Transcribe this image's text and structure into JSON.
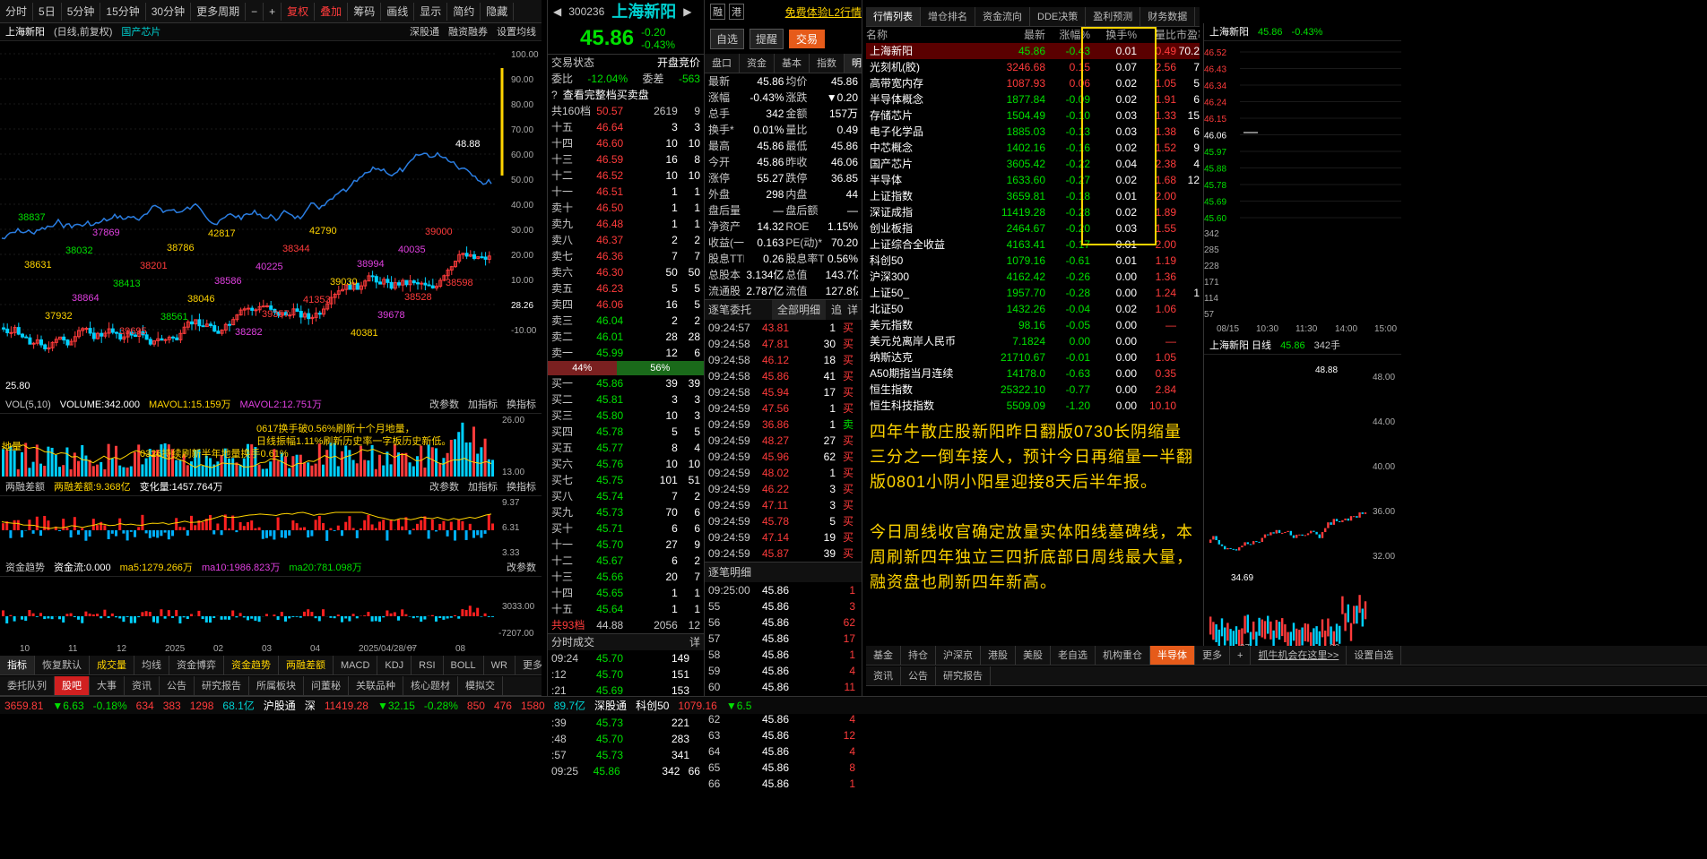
{
  "toolbar": {
    "items": [
      "分时",
      "5日",
      "5分钟",
      "15分钟",
      "30分钟",
      "更多周期"
    ],
    "tools": [
      "复权",
      "叠加",
      "筹码",
      "画线",
      "显示",
      "简约",
      "隐藏"
    ]
  },
  "chart_head": {
    "name": "上海新阳",
    "desc": "(日线,前复权)",
    "tag": "国产芯片",
    "deep": "深股通",
    "rz": "融资融券",
    "set": "设置均线"
  },
  "main_chart": {
    "high_label": "48.88",
    "low_label": "25.80",
    "y_ticks": [
      "100.00",
      "90.00",
      "80.00",
      "70.00",
      "60.00",
      "50.00",
      "40.00",
      "30.00",
      "20.00",
      "10.00",
      "28.26",
      "-10.00"
    ],
    "annos": [
      "38837",
      "38032",
      "38413",
      "38561",
      "42817",
      "40225",
      "41353",
      "40381",
      "40035",
      "38598",
      "37932",
      "37869",
      "38201",
      "38046",
      "38282",
      "38344",
      "39030",
      "39678",
      "39000",
      "38631",
      "38864",
      "39695",
      "38786",
      "38586",
      "39357",
      "42790",
      "38994",
      "38528"
    ]
  },
  "vol": {
    "title": "VOL(5,10)",
    "vol": "VOLUME:342.000",
    "m1": "MAVOL1:15.159万",
    "m2": "MAVOL2:12.751万",
    "btns": [
      "改参数",
      "加指标",
      "换指标"
    ],
    "note1": "0617换手破0.56%刷新十个月地量，",
    "note2": "日线振幅1.11%刷新历史率一字板历史新低。",
    "note3": "0326持续刷新半年地量换手0.61%",
    "note4": "地量",
    "ticks": [
      "26.00",
      "",
      "13.00"
    ]
  },
  "rz": {
    "title": "两融差额",
    "val": "两融差额:9.368亿",
    "chg": "变化量:1457.764万",
    "ticks": [
      "9.37",
      "6.31",
      "3.33"
    ]
  },
  "zj": {
    "title": "资金趋势",
    "val": "资金流:0.000",
    "m5": "ma5:1279.266万",
    "m10": "ma10:1986.823万",
    "m20": "ma20:781.098万",
    "ticks": [
      "3033.00",
      "-7207.00"
    ]
  },
  "x_axis": [
    "10",
    "11",
    "12",
    "2025",
    "02",
    "03",
    "04",
    "2025/04/28/一",
    "07",
    "08"
  ],
  "bottom_tabs": [
    "指标",
    "恢复默认",
    "成交量",
    "均线",
    "资金博弈",
    "资金趋势",
    "两融差额",
    "MACD",
    "KDJ",
    "RSI",
    "BOLL",
    "WR",
    "更多",
    "模板"
  ],
  "tabs2": [
    "委托队列",
    "股吧",
    "大事",
    "资讯",
    "公告",
    "研究报告",
    "所属板块",
    "问董秘",
    "关联品种",
    "核心题材",
    "模拟交"
  ],
  "quote": {
    "code": "300236",
    "name": "上海新阳",
    "price": "45.86",
    "chg": "-0.20",
    "pct": "-0.43%",
    "b1": "融",
    "b2": "港",
    "l2": "免费体验L2行情",
    "zx": "自选",
    "tx": "提醒",
    "jy": "交易"
  },
  "order_status": {
    "label": "交易状态",
    "val": "开盘竞价",
    "wb": "委比",
    "wbv": "-12.04%",
    "wc": "委差",
    "wcv": "-563",
    "view": "查看完整档买卖盘",
    "total": "共160档",
    "tp": "50.57",
    "tv": "2619",
    "tn": "9"
  },
  "asks": [
    [
      "十五",
      "46.64",
      "3",
      "3"
    ],
    [
      "十四",
      "46.60",
      "10",
      "10"
    ],
    [
      "十三",
      "46.59",
      "16",
      "8"
    ],
    [
      "十二",
      "46.52",
      "10",
      "10"
    ],
    [
      "十一",
      "46.51",
      "1",
      "1"
    ],
    [
      "卖十",
      "46.50",
      "1",
      "1"
    ],
    [
      "卖九",
      "46.48",
      "1",
      "1"
    ],
    [
      "卖八",
      "46.37",
      "2",
      "2"
    ],
    [
      "卖七",
      "46.36",
      "7",
      "7"
    ],
    [
      "卖六",
      "46.30",
      "50",
      "50"
    ],
    [
      "卖五",
      "46.23",
      "5",
      "5"
    ],
    [
      "卖四",
      "46.06",
      "16",
      "5"
    ],
    [
      "卖三",
      "46.04",
      "2",
      "2"
    ],
    [
      "卖二",
      "46.01",
      "28",
      "28"
    ],
    [
      "卖一",
      "45.99",
      "12",
      "6"
    ]
  ],
  "ratio": {
    "l": "44%",
    "r": "56%"
  },
  "bids": [
    [
      "买一",
      "45.86",
      "39",
      "39"
    ],
    [
      "买二",
      "45.81",
      "3",
      "3"
    ],
    [
      "买三",
      "45.80",
      "10",
      "3"
    ],
    [
      "买四",
      "45.78",
      "5",
      "5"
    ],
    [
      "买五",
      "45.77",
      "8",
      "4"
    ],
    [
      "买六",
      "45.76",
      "10",
      "10"
    ],
    [
      "买七",
      "45.75",
      "101",
      "51"
    ],
    [
      "买八",
      "45.74",
      "7",
      "2"
    ],
    [
      "买九",
      "45.73",
      "70",
      "6"
    ],
    [
      "买十",
      "45.71",
      "6",
      "6"
    ],
    [
      "十一",
      "45.70",
      "27",
      "9"
    ],
    [
      "十二",
      "45.67",
      "6",
      "2"
    ],
    [
      "十三",
      "45.66",
      "20",
      "7"
    ],
    [
      "十四",
      "45.65",
      "1",
      "1"
    ],
    [
      "十五",
      "45.64",
      "1",
      "1"
    ]
  ],
  "bid_total": {
    "l": "共93档",
    "p": "44.88",
    "v": "2056",
    "n": "12"
  },
  "fs": {
    "title": "分时成交",
    "btn": "详",
    "rows": [
      [
        "09:24",
        "45.70",
        "149"
      ],
      [
        ":12",
        "45.70",
        "151"
      ],
      [
        ":21",
        "45.69",
        "153"
      ],
      [
        ":30",
        "45.73",
        "187"
      ],
      [
        ":39",
        "45.73",
        "221"
      ],
      [
        ":48",
        "45.70",
        "283"
      ],
      [
        ":57",
        "45.73",
        "341"
      ],
      [
        "09:25",
        "45.86",
        "342",
        "66"
      ]
    ]
  },
  "mtabs": [
    "盘口",
    "资金",
    "基本",
    "指数",
    "明细",
    "逐笔"
  ],
  "detail": [
    [
      "最新",
      "45.86",
      "均价",
      "45.86"
    ],
    [
      "涨幅",
      "-0.43%",
      "涨跌",
      "▼0.20"
    ],
    [
      "总手",
      "342",
      "金额",
      "157万"
    ],
    [
      "换手*",
      "0.01%",
      "量比",
      "0.49"
    ],
    [
      "最高",
      "45.86",
      "最低",
      "45.86"
    ],
    [
      "今开",
      "45.86",
      "昨收",
      "46.06"
    ],
    [
      "涨停",
      "55.27",
      "跌停",
      "36.85"
    ],
    [
      "外盘",
      "298",
      "内盘",
      "44"
    ],
    [
      "盘后量",
      "—",
      "盘后额",
      "—"
    ],
    [
      "净资产",
      "14.32",
      "ROE",
      "1.15%"
    ],
    [
      "收益(一)",
      "0.163",
      "PE(动)*",
      "70.20"
    ],
    [
      "股息TTM",
      "0.26",
      "股息率TTM",
      "0.56%"
    ],
    [
      "总股本",
      "3.134亿",
      "总值",
      "143.7亿"
    ],
    [
      "流通股",
      "2.787亿",
      "流值",
      "127.8亿"
    ]
  ],
  "zbwt": {
    "title": "逐笔委托",
    "sel": "全部明细",
    "b1": "追",
    "b2": "详",
    "rows": [
      [
        "09:24:57",
        "43.81",
        "1",
        "买"
      ],
      [
        "09:24:58",
        "47.81",
        "30",
        "买"
      ],
      [
        "09:24:58",
        "46.12",
        "18",
        "买"
      ],
      [
        "09:24:58",
        "45.86",
        "41",
        "买"
      ],
      [
        "09:24:58",
        "45.94",
        "17",
        "买"
      ],
      [
        "09:24:59",
        "47.56",
        "1",
        "买"
      ],
      [
        "09:24:59",
        "36.86",
        "1",
        "卖"
      ],
      [
        "09:24:59",
        "48.27",
        "27",
        "买"
      ],
      [
        "09:24:59",
        "45.96",
        "62",
        "买"
      ],
      [
        "09:24:59",
        "48.02",
        "1",
        "买"
      ],
      [
        "09:24:59",
        "46.22",
        "3",
        "买"
      ],
      [
        "09:24:59",
        "47.11",
        "3",
        "买"
      ],
      [
        "09:24:59",
        "45.78",
        "5",
        "买"
      ],
      [
        "09:24:59",
        "47.14",
        "19",
        "买"
      ],
      [
        "09:24:59",
        "45.87",
        "39",
        "买"
      ]
    ]
  },
  "zbmx": {
    "title": "逐笔明细",
    "rows": [
      [
        "09:25:00",
        "45.86",
        "1"
      ],
      [
        "55",
        "45.86",
        "3"
      ],
      [
        "56",
        "45.86",
        "62"
      ],
      [
        "57",
        "45.86",
        "17"
      ],
      [
        "58",
        "45.86",
        "1"
      ],
      [
        "59",
        "45.86",
        "4"
      ],
      [
        "60",
        "45.86",
        "11"
      ],
      [
        "61",
        "45.86",
        "2"
      ],
      [
        "62",
        "45.86",
        "4"
      ],
      [
        "63",
        "45.86",
        "12"
      ],
      [
        "64",
        "45.86",
        "4"
      ],
      [
        "65",
        "45.86",
        "8"
      ],
      [
        "66",
        "45.86",
        "1"
      ]
    ]
  },
  "rtabs": [
    "行情列表",
    "增仓排名",
    "资金流向",
    "DDE决策",
    "盈利预测",
    "财务数据",
    "阶段统计",
    "参股同列"
  ],
  "list_head": [
    "名称",
    "最新",
    "涨幅%",
    "换手%",
    "量比",
    "市盈率"
  ],
  "list": [
    [
      "上海新阳",
      "45.86",
      "-0.43",
      "0.01",
      "0.49",
      "70.2"
    ],
    [
      "光刻机(胶)",
      "3246.68",
      "0.15",
      "0.07",
      "2.56",
      "7"
    ],
    [
      "高带宽内存",
      "1087.93",
      "0.06",
      "0.02",
      "1.05",
      "5"
    ],
    [
      "半导体概念",
      "1877.84",
      "-0.09",
      "0.02",
      "1.91",
      "6"
    ],
    [
      "存储芯片",
      "1504.49",
      "-0.10",
      "0.03",
      "1.33",
      "15"
    ],
    [
      "电子化学品",
      "1885.03",
      "-0.13",
      "0.03",
      "1.38",
      "6"
    ],
    [
      "中芯概念",
      "1402.16",
      "-0.16",
      "0.02",
      "1.52",
      "9"
    ],
    [
      "国产芯片",
      "3605.42",
      "-0.22",
      "0.04",
      "2.38",
      "4"
    ],
    [
      "半导体",
      "1633.60",
      "-0.27",
      "0.02",
      "1.68",
      "12"
    ],
    [
      "上证指数",
      "3659.81",
      "-0.18",
      "0.01",
      "2.00",
      ""
    ],
    [
      "深证成指",
      "11419.28",
      "-0.28",
      "0.02",
      "1.89",
      ""
    ],
    [
      "创业板指",
      "2464.67",
      "-0.20",
      "0.03",
      "1.55",
      ""
    ],
    [
      "上证综合全收益",
      "4163.41",
      "-0.17",
      "0.01",
      "2.00",
      ""
    ],
    [
      "科创50",
      "1079.16",
      "-0.61",
      "0.01",
      "1.19",
      ""
    ],
    [
      "沪深300",
      "4162.42",
      "-0.26",
      "0.00",
      "1.36",
      ""
    ],
    [
      "上证50_",
      "1957.70",
      "-0.28",
      "0.00",
      "1.24",
      "1"
    ],
    [
      "北证50",
      "1432.26",
      "-0.04",
      "0.02",
      "1.06",
      ""
    ],
    [
      "美元指数",
      "98.16",
      "-0.05",
      "0.00",
      "—",
      ""
    ],
    [
      "美元兑离岸人民币",
      "7.1824",
      "0.00",
      "0.00",
      "—",
      ""
    ],
    [
      "纳斯达克",
      "21710.67",
      "-0.01",
      "0.00",
      "1.05",
      ""
    ],
    [
      "A50期指当月连续",
      "14178.0",
      "-0.63",
      "0.00",
      "0.35",
      ""
    ],
    [
      "恒生指数",
      "25322.10",
      "-0.77",
      "0.00",
      "2.84",
      ""
    ],
    [
      "恒生科技指数",
      "5509.09",
      "-1.20",
      "0.00",
      "10.10",
      ""
    ]
  ],
  "news": {
    "p1": "四年牛散庄股新阳昨日翻版0730长阴缩量三分之一倒车接人，预计今日再缩量一半翻版0801小阴小阳星迎接8天后半年报。",
    "p2": "今日周线收官确定放量实体阳线墓碑线，本周刷新四年独立三四折底部日周线最大量，融资盘也刷新四年新高。"
  },
  "mini": {
    "name": "上海新阳",
    "price": "45.86",
    "pct": "-0.43%",
    "ticks": [
      "46.52",
      "46.43",
      "46.34",
      "46.24",
      "46.15",
      "46.06",
      "45.97",
      "45.88",
      "45.78",
      "45.69",
      "45.60"
    ],
    "vticks": [
      "342",
      "285",
      "228",
      "171",
      "114",
      "57"
    ],
    "xt": [
      "08/15",
      "10:30",
      "11:30",
      "14:00",
      "15:00"
    ]
  },
  "kmini": {
    "name": "上海新阳 日线",
    "price": "45.86",
    "v": "342手",
    "hi": "48.88",
    "lo": "34.69",
    "ticks": [
      "48.00",
      "44.00",
      "40.00",
      "36.00",
      "32.00"
    ],
    "xt": [
      "07",
      "08"
    ]
  },
  "rbtabs": [
    "基金",
    "持仓",
    "沪深京",
    "港股",
    "美股",
    "老自选",
    "机构重仓",
    "半导体",
    "更多",
    "+"
  ],
  "rb_ad": "抓牛机会在这里>>",
  "rb_set": "设置自选",
  "rbtabs2": [
    "资讯",
    "公告",
    "研究报告"
  ],
  "status": [
    [
      "3659.81",
      "▼6.63",
      "-0.18%",
      "634",
      "383",
      "1298",
      "68.1亿",
      "沪股通"
    ],
    [
      "深",
      "11419.28",
      "▼32.15",
      "-0.28%",
      "850",
      "476",
      "1580",
      "89.7亿",
      "深股通"
    ],
    [
      "科创50",
      "1079.16",
      "▼6.5"
    ]
  ]
}
